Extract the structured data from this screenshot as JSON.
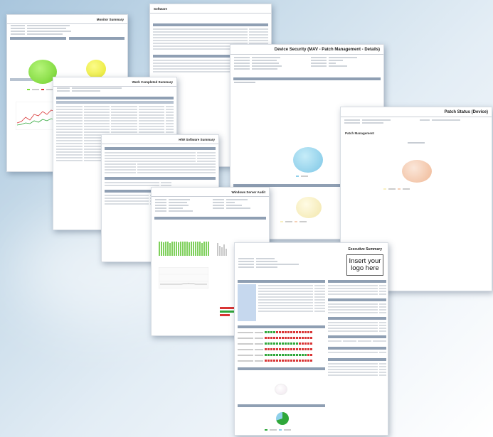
{
  "pages": {
    "monitor": {
      "title": "Monitor Summary"
    },
    "work_completed": {
      "title": "Work Completed Summary"
    },
    "software": {
      "title": "Software"
    },
    "device_security": {
      "title": "Device Security (MAV - Patch Management - Details)"
    },
    "patch_status": {
      "title": "Patch Status (Device)",
      "section": "Patch Management"
    },
    "hw_sw_summary": {
      "title": "H/W Software Summary"
    },
    "windows_server_audit": {
      "title": "Windows Server Audit"
    },
    "executive_summary": {
      "title": "Executive Summary",
      "logo_text": "Insert your logo here"
    }
  },
  "colors": {
    "section_bar": "#8f9fb3",
    "pie_green": "#7fe03a",
    "pie_yellow": "#f0f040",
    "pie_blue": "#8fd0ea",
    "pie_cream": "#f7efc0",
    "pie_peach": "#f6d0b6",
    "bar_green": "#2fa73a",
    "bar_red": "#d93535"
  }
}
